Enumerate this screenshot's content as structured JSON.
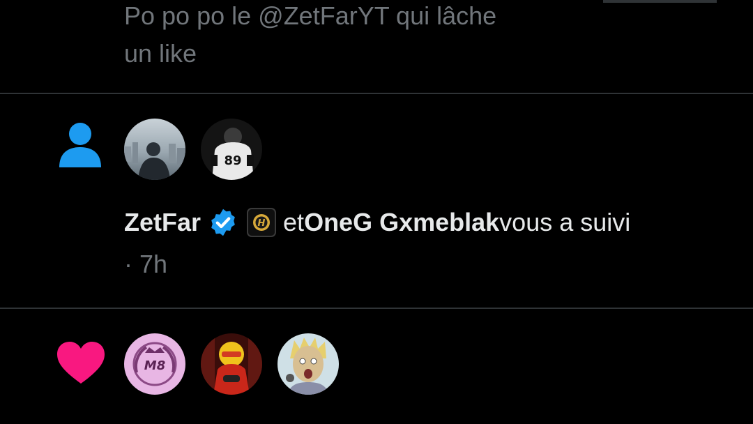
{
  "previous_notification": {
    "text_line1": "Po po po le @ZetFarYT qui lâche",
    "text_line2": "un like"
  },
  "follow_notification": {
    "icon": "person-icon",
    "user1_name": "ZetFar",
    "verified_icon": "verified-badge-icon",
    "affiliate_icon": "affiliate-badge-icon",
    "connector": "et",
    "user2_name": "OneG Gxmeblak",
    "action": "vous a suivi",
    "time": "· 7h"
  },
  "like_notification": {
    "icon": "heart-icon"
  },
  "colors": {
    "background": "#000000",
    "primary_text": "#e7e9ea",
    "secondary_text": "#71767b",
    "divider": "#2f3336",
    "follow_icon": "#1d9bf0",
    "like_icon": "#f91880"
  }
}
